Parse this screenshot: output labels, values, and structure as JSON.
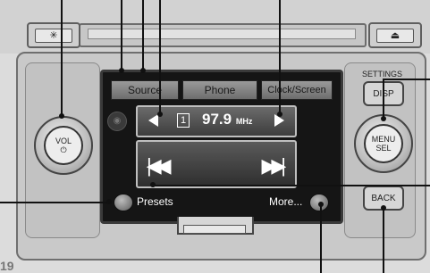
{
  "tabs": [
    "Source",
    "Phone",
    "Clock/Screen"
  ],
  "radio": {
    "preset": "1",
    "frequency": "97.9",
    "unit": "MHz"
  },
  "soft_buttons": {
    "presets": "Presets",
    "more": "More..."
  },
  "knob_left": {
    "label": "VOL",
    "symbol": "⏻"
  },
  "knob_right": {
    "line1": "MENU",
    "line2": "SEL"
  },
  "right_buttons": {
    "settings": "SETTINGS",
    "disp": "DISP",
    "back": "BACK"
  },
  "top_buttons": {
    "left_symbol": "✳",
    "right_symbol": "⏏"
  },
  "corner_mark": "19"
}
